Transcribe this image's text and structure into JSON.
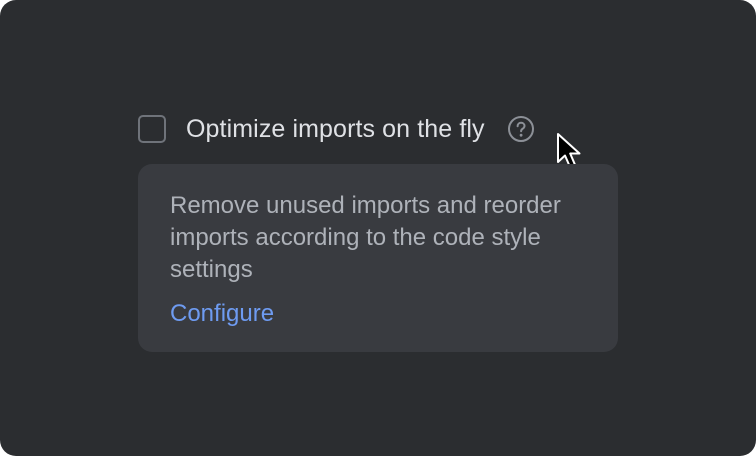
{
  "option": {
    "checked": false,
    "label": "Optimize imports on the fly",
    "help_icon": "question-circle-icon"
  },
  "tooltip": {
    "text": "Remove unused imports and reorder imports according to the code style settings",
    "link_label": "Configure"
  },
  "cursor": "pointer-arrow-icon",
  "colors": {
    "panel_bg": "#2b2d30",
    "tooltip_bg": "#393b40",
    "label_text": "#dfe1e5",
    "tooltip_text": "#aeb2b9",
    "link": "#6e9bf1",
    "checkbox_border": "#6f737a"
  }
}
